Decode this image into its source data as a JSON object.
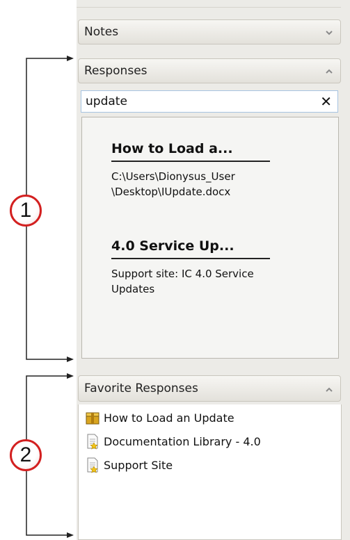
{
  "sections": {
    "notes": {
      "title": "Notes"
    },
    "responses": {
      "title": "Responses"
    },
    "favorites": {
      "title": "Favorite Responses"
    }
  },
  "search": {
    "value": "update",
    "clear_glyph": "✕"
  },
  "results": [
    {
      "title": "How to Load a...",
      "desc": "C:\\Users\\Dionysus_User \\Desktop\\IUpdate.docx"
    },
    {
      "title": "4.0 Service Up...",
      "desc": "Support site: IC 4.0 Service Updates"
    }
  ],
  "favorites_items": [
    {
      "label": "How to Load an Update",
      "icon": "package-icon"
    },
    {
      "label": "Documentation Library - 4.0",
      "icon": "document-star-icon"
    },
    {
      "label": "Support Site",
      "icon": "document-star-icon"
    }
  ],
  "callouts": {
    "one": "1",
    "two": "2"
  },
  "colors": {
    "callout_border": "#d32020",
    "search_border": "#a6c3e1",
    "panel_bg": "#ecebe7"
  }
}
